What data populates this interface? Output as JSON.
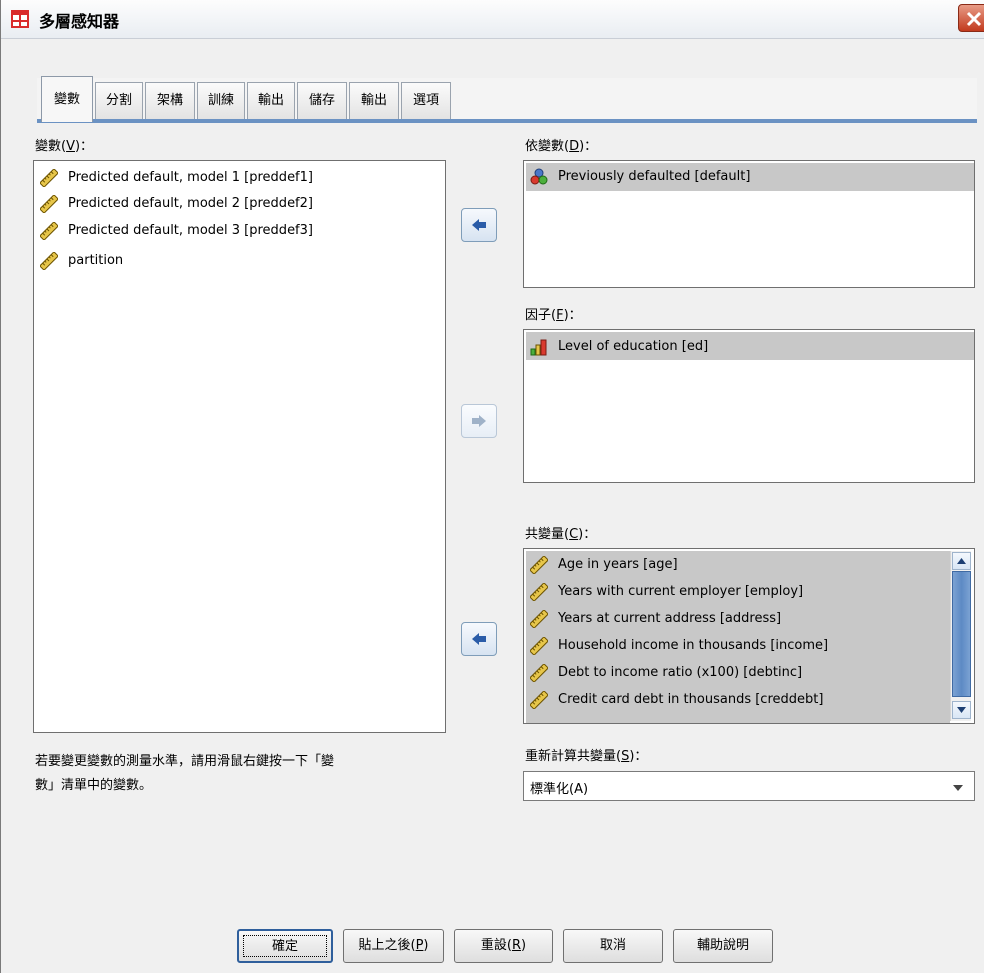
{
  "window": {
    "title": "多層感知器"
  },
  "tabs": [
    "變數",
    "分割",
    "架構",
    "訓練",
    "輸出",
    "儲存",
    "輸出",
    "選項"
  ],
  "variables": {
    "label_prefix": "變數(",
    "label_key": "V",
    "label_suffix": ")：",
    "items": [
      "Predicted default, model 1 [preddef1]",
      "Predicted default, model 2 [preddef2]",
      "Predicted default, model 3 [preddef3]",
      "partition"
    ]
  },
  "dependent": {
    "label_prefix": "依變數(",
    "label_key": "D",
    "label_suffix": ")：",
    "items": [
      "Previously defaulted [default]"
    ]
  },
  "factors": {
    "label_prefix": "因子(",
    "label_key": "F",
    "label_suffix": ")：",
    "items": [
      "Level of education [ed]"
    ]
  },
  "covariates": {
    "label_prefix": "共變量(",
    "label_key": "C",
    "label_suffix": ")：",
    "items": [
      "Age in years [age]",
      "Years with current employer [employ]",
      "Years at current address [address]",
      "Household income in thousands [income]",
      "Debt to income ratio (x100) [debtinc]",
      "Credit card debt in thousands [creddebt]"
    ]
  },
  "hint": {
    "line1": "若要變更變數的測量水準，請用滑鼠右鍵按一下「變",
    "line2": "數」清單中的變數。"
  },
  "rescale": {
    "label_prefix": "重新計算共變量(",
    "label_key": "S",
    "label_suffix": ")：",
    "value": "標準化(A)"
  },
  "buttons": {
    "ok": "確定",
    "paste_prefix": "貼上之後(",
    "paste_key": "P",
    "paste_suffix": ")",
    "reset_prefix": "重設(",
    "reset_key": "R",
    "reset_suffix": ")",
    "cancel": "取消",
    "help": "輔助說明"
  },
  "colors": {
    "tab_accent": "#6b92c3",
    "selection": "#c8c8c8",
    "close_button": "#c23a1e"
  },
  "icons": {
    "scale_variable": "ruler-icon",
    "nominal_variable": "nominal-circles-icon",
    "ordinal_variable": "ordinal-bars-icon"
  }
}
